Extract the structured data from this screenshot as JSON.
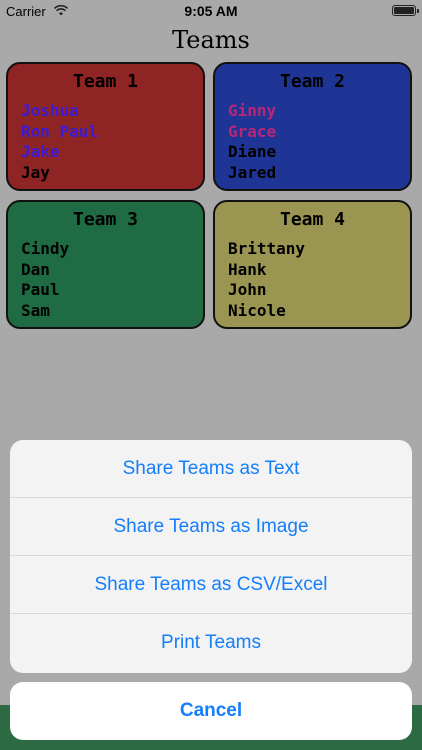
{
  "status_bar": {
    "carrier": "Carrier",
    "time": "9:05 AM"
  },
  "title": "Teams",
  "teams": [
    {
      "name": "Team 1",
      "members": [
        {
          "name": "Joshua",
          "color": "#3b1bd6"
        },
        {
          "name": "Ron Paul",
          "color": "#3b1bd6"
        },
        {
          "name": "Jake",
          "color": "#3b1bd6"
        },
        {
          "name": "Jay",
          "color": "#000000"
        }
      ]
    },
    {
      "name": "Team 2",
      "members": [
        {
          "name": "Ginny",
          "color": "#b82677"
        },
        {
          "name": "Grace",
          "color": "#b82677"
        },
        {
          "name": "Diane",
          "color": "#000000"
        },
        {
          "name": "Jared",
          "color": "#000000"
        }
      ]
    },
    {
      "name": "Team 3",
      "members": [
        {
          "name": "Cindy",
          "color": "#000000"
        },
        {
          "name": "Dan",
          "color": "#000000"
        },
        {
          "name": "Paul",
          "color": "#000000"
        },
        {
          "name": "Sam",
          "color": "#000000"
        }
      ]
    },
    {
      "name": "Team 4",
      "members": [
        {
          "name": "Brittany",
          "color": "#000000"
        },
        {
          "name": "Hank",
          "color": "#000000"
        },
        {
          "name": "John",
          "color": "#000000"
        },
        {
          "name": "Nicole",
          "color": "#000000"
        }
      ]
    }
  ],
  "action_sheet": {
    "share_text": "Share Teams as Text",
    "share_image": "Share Teams as Image",
    "share_csv": "Share Teams as CSV/Excel",
    "print": "Print Teams",
    "cancel": "Cancel"
  },
  "colors": {
    "team1_bg": "#8f2424",
    "team2_bg": "#1f3596",
    "team3_bg": "#1f6b43",
    "team4_bg": "#9a9551",
    "action_blue": "#147efb"
  }
}
